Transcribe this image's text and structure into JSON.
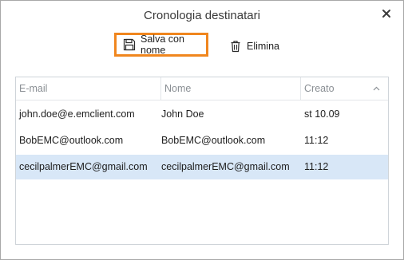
{
  "dialog": {
    "title": "Cronologia destinatari"
  },
  "toolbar": {
    "save_label": "Salva con nome",
    "delete_label": "Elimina"
  },
  "table": {
    "columns": [
      "E-mail",
      "Nome",
      "Creato"
    ],
    "rows": [
      {
        "email": "john.doe@e.emclient.com",
        "name": "John Doe",
        "created": "st 10.09"
      },
      {
        "email": "BobEMC@outlook.com",
        "name": "BobEMC@outlook.com",
        "created": "11:12"
      },
      {
        "email": "cecilpalmerEMC@gmail.com",
        "name": "cecilpalmerEMC@gmail.com",
        "created": "11:12"
      }
    ],
    "selected_row": 2
  },
  "colors": {
    "highlight_border": "#f0861e",
    "selected_row": "#d8e7f7"
  },
  "icons": {
    "close": "close-icon",
    "save": "floppy-disk-icon",
    "delete": "trash-icon",
    "sort": "chevron-up-icon"
  }
}
